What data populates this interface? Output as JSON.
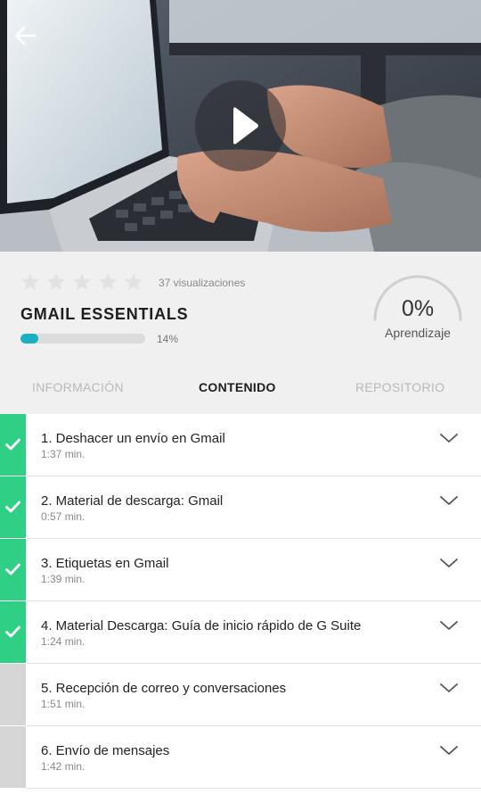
{
  "hero": {
    "back_icon": "arrow-left-icon",
    "play_icon": "play-icon"
  },
  "course": {
    "rating_stars": 5,
    "rating_filled": 0,
    "views": "37 visualizaciones",
    "title": "GMAIL ESSENTIALS",
    "progress": 0.14,
    "progress_label": "14%",
    "learning_value": "0%",
    "learning_fraction": 0,
    "learning_label": "Aprendizaje"
  },
  "tabs": {
    "info": "INFORMACIÓN",
    "content": "CONTENIDO",
    "repo": "REPOSITORIO",
    "active": "content"
  },
  "lessons": [
    {
      "title": "1. Deshacer un envío en Gmail",
      "duration": "1:37 min.",
      "completed": true
    },
    {
      "title": "2. Material de descarga: Gmail",
      "duration": "0:57 min.",
      "completed": true
    },
    {
      "title": "3. Etiquetas en Gmail",
      "duration": "1:39 min.",
      "completed": true
    },
    {
      "title": "4. Material Descarga: Guía de inicio rápido de G Suite",
      "duration": "1:24 min.",
      "completed": true
    },
    {
      "title": "5. Recepción de correo y conversaciones",
      "duration": "1:51 min.",
      "completed": false
    },
    {
      "title": "6. Envío de mensajes",
      "duration": "1:42 min.",
      "completed": false
    }
  ],
  "colors": {
    "completed": "#2fcf86",
    "pending": "#d6d6d6",
    "progress": "#19b1c2"
  }
}
